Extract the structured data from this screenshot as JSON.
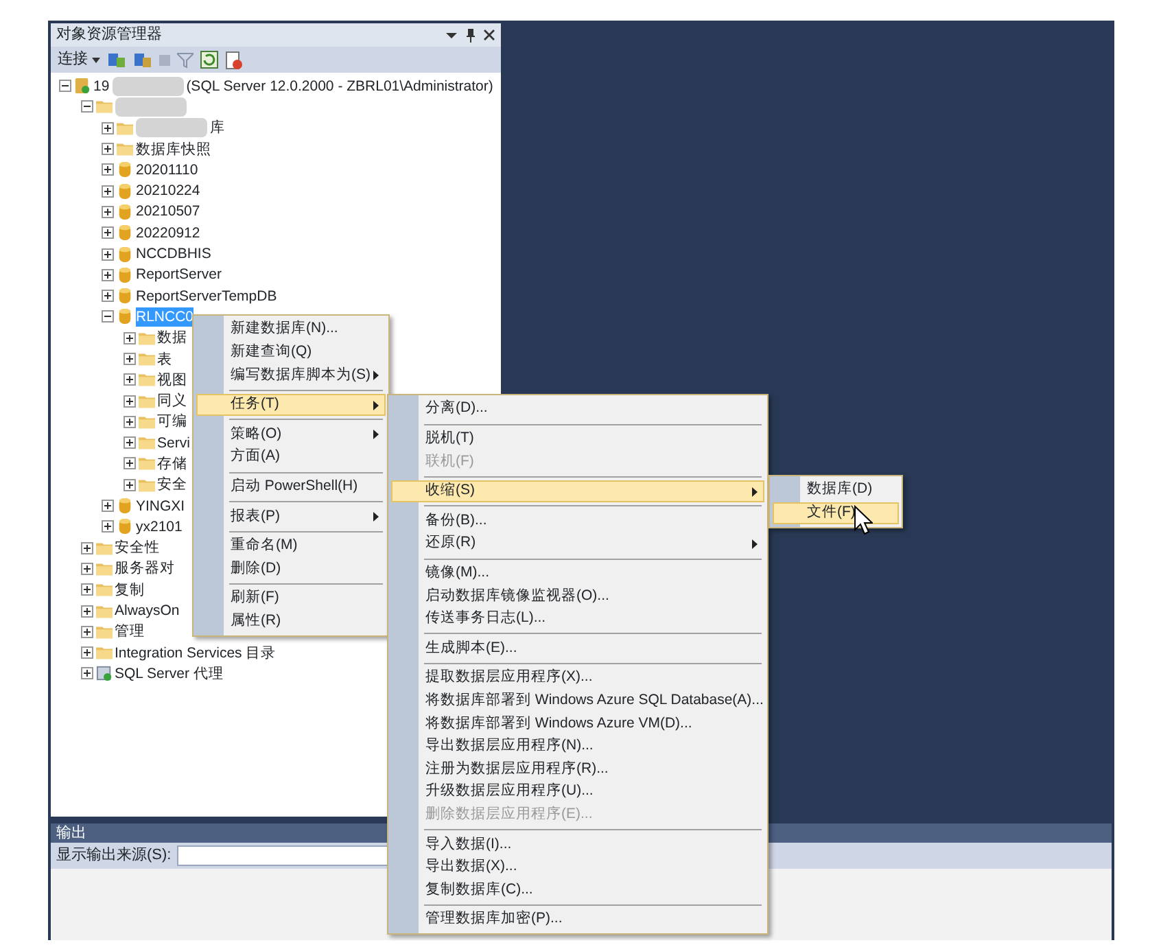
{
  "panel": {
    "title": "对象资源管理器"
  },
  "toolbar": {
    "connect_label": "连接"
  },
  "tree": [
    {
      "kind": "server",
      "label": "19",
      "redacted": true,
      "label_suffix": "(SQL Server 12.0.2000 - ZBRL01\\Administrator)",
      "expanded": true,
      "selected": false,
      "children": [
        {
          "kind": "folder",
          "redacted": true,
          "expanded": true,
          "selected": false,
          "children": [
            {
              "kind": "folder",
              "redacted": true,
              "label": "库",
              "expanded": false,
              "selected": false
            },
            {
              "kind": "folder",
              "label": "数据库快照",
              "expanded": false,
              "selected": false
            },
            {
              "kind": "database",
              "label": "20201110",
              "expanded": false,
              "selected": false
            },
            {
              "kind": "database",
              "label": "20210224",
              "expanded": false,
              "selected": false
            },
            {
              "kind": "database",
              "label": "20210507",
              "expanded": false,
              "selected": false
            },
            {
              "kind": "database",
              "label": "20220912",
              "expanded": false,
              "selected": false
            },
            {
              "kind": "database",
              "label": "NCCDBHIS",
              "expanded": false,
              "selected": false
            },
            {
              "kind": "database",
              "label": "ReportServer",
              "expanded": false,
              "selected": false
            },
            {
              "kind": "database",
              "label": "ReportServerTempDB",
              "expanded": false,
              "selected": false
            },
            {
              "kind": "database",
              "label": "RLNCC0",
              "expanded": true,
              "selected": true,
              "children": [
                {
                  "kind": "folder",
                  "label": "数据",
                  "expanded": false,
                  "selected": false
                },
                {
                  "kind": "folder",
                  "label": "表",
                  "expanded": false,
                  "selected": false
                },
                {
                  "kind": "folder",
                  "label": "视图",
                  "expanded": false,
                  "selected": false
                },
                {
                  "kind": "folder",
                  "label": "同义",
                  "expanded": false,
                  "selected": false
                },
                {
                  "kind": "folder",
                  "label": "可编",
                  "expanded": false,
                  "selected": false
                },
                {
                  "kind": "folder",
                  "label": "Servi",
                  "expanded": false,
                  "selected": false
                },
                {
                  "kind": "folder",
                  "label": "存储",
                  "expanded": false,
                  "selected": false
                },
                {
                  "kind": "folder",
                  "label": "安全",
                  "expanded": false,
                  "selected": false
                }
              ]
            },
            {
              "kind": "database",
              "label": "YINGXI",
              "expanded": false,
              "selected": false
            },
            {
              "kind": "database",
              "label": "yx2101",
              "expanded": false,
              "selected": false
            }
          ]
        },
        {
          "kind": "folder",
          "label": "安全性",
          "expanded": false,
          "selected": false
        },
        {
          "kind": "folder",
          "label": "服务器对",
          "expanded": false,
          "selected": false
        },
        {
          "kind": "folder",
          "label": "复制",
          "expanded": false,
          "selected": false
        },
        {
          "kind": "folder",
          "label": "AlwaysOn",
          "expanded": false,
          "selected": false
        },
        {
          "kind": "folder",
          "label": "管理",
          "expanded": false,
          "selected": false
        },
        {
          "kind": "folder",
          "label": "Integration Services 目录",
          "expanded": false,
          "selected": false
        },
        {
          "kind": "agent",
          "label": "SQL Server 代理",
          "expanded": false,
          "selected": false
        }
      ]
    }
  ],
  "context_menus": [
    {
      "items": [
        {
          "kind": "item",
          "label": "新建数据库(N)...",
          "disabled": false,
          "selected": false
        },
        {
          "kind": "item",
          "label": "新建查询(Q)",
          "disabled": false,
          "selected": false
        },
        {
          "kind": "item",
          "label": "编写数据库脚本为(S)",
          "submenu": true,
          "disabled": false,
          "selected": false
        },
        {
          "kind": "separator"
        },
        {
          "kind": "item",
          "label": "任务(T)",
          "submenu": true,
          "disabled": false,
          "selected": true
        },
        {
          "kind": "separator"
        },
        {
          "kind": "item",
          "label": "策略(O)",
          "submenu": true,
          "disabled": false,
          "selected": false
        },
        {
          "kind": "item",
          "label": "方面(A)",
          "disabled": false,
          "selected": false
        },
        {
          "kind": "separator"
        },
        {
          "kind": "item",
          "label": "启动 PowerShell(H)",
          "disabled": false,
          "selected": false
        },
        {
          "kind": "separator"
        },
        {
          "kind": "item",
          "label": "报表(P)",
          "submenu": true,
          "disabled": false,
          "selected": false
        },
        {
          "kind": "separator"
        },
        {
          "kind": "item",
          "label": "重命名(M)",
          "disabled": false,
          "selected": false
        },
        {
          "kind": "item",
          "label": "删除(D)",
          "disabled": false,
          "selected": false
        },
        {
          "kind": "separator"
        },
        {
          "kind": "item",
          "label": "刷新(F)",
          "disabled": false,
          "selected": false
        },
        {
          "kind": "item",
          "label": "属性(R)",
          "disabled": false,
          "selected": false
        }
      ]
    },
    {
      "items": [
        {
          "kind": "item",
          "label": "分离(D)...",
          "disabled": false,
          "selected": false
        },
        {
          "kind": "separator"
        },
        {
          "kind": "item",
          "label": "脱机(T)",
          "disabled": false,
          "selected": false
        },
        {
          "kind": "item",
          "label": "联机(F)",
          "disabled": true,
          "selected": false
        },
        {
          "kind": "separator"
        },
        {
          "kind": "item",
          "label": "收缩(S)",
          "submenu": true,
          "disabled": false,
          "selected": true
        },
        {
          "kind": "separator"
        },
        {
          "kind": "item",
          "label": "备份(B)...",
          "disabled": false,
          "selected": false
        },
        {
          "kind": "item",
          "label": "还原(R)",
          "submenu": true,
          "disabled": false,
          "selected": false
        },
        {
          "kind": "separator"
        },
        {
          "kind": "item",
          "label": "镜像(M)...",
          "disabled": false,
          "selected": false
        },
        {
          "kind": "item",
          "label": "启动数据库镜像监视器(O)...",
          "disabled": false,
          "selected": false
        },
        {
          "kind": "item",
          "label": "传送事务日志(L)...",
          "disabled": false,
          "selected": false
        },
        {
          "kind": "separator"
        },
        {
          "kind": "item",
          "label": "生成脚本(E)...",
          "disabled": false,
          "selected": false
        },
        {
          "kind": "separator"
        },
        {
          "kind": "item",
          "label": "提取数据层应用程序(X)...",
          "disabled": false,
          "selected": false
        },
        {
          "kind": "item",
          "label": "将数据库部署到 Windows Azure SQL Database(A)...",
          "disabled": false,
          "selected": false
        },
        {
          "kind": "item",
          "label": "将数据库部署到 Windows Azure VM(D)...",
          "disabled": false,
          "selected": false
        },
        {
          "kind": "item",
          "label": "导出数据层应用程序(N)...",
          "disabled": false,
          "selected": false
        },
        {
          "kind": "item",
          "label": "注册为数据层应用程序(R)...",
          "disabled": false,
          "selected": false
        },
        {
          "kind": "item",
          "label": "升级数据层应用程序(U)...",
          "disabled": false,
          "selected": false
        },
        {
          "kind": "item",
          "label": "删除数据层应用程序(E)...",
          "disabled": true,
          "selected": false
        },
        {
          "kind": "separator"
        },
        {
          "kind": "item",
          "label": "导入数据(I)...",
          "disabled": false,
          "selected": false
        },
        {
          "kind": "item",
          "label": "导出数据(X)...",
          "disabled": false,
          "selected": false
        },
        {
          "kind": "item",
          "label": "复制数据库(C)...",
          "disabled": false,
          "selected": false
        },
        {
          "kind": "separator"
        },
        {
          "kind": "item",
          "label": "管理数据库加密(P)...",
          "disabled": false,
          "selected": false
        }
      ]
    },
    {
      "items": [
        {
          "kind": "item",
          "label": "数据库(D)",
          "disabled": false,
          "selected": false
        },
        {
          "kind": "item",
          "label": "文件(F)",
          "disabled": false,
          "selected": true
        }
      ]
    }
  ],
  "output": {
    "title": "输出",
    "source_label": "显示输出来源(S):"
  }
}
